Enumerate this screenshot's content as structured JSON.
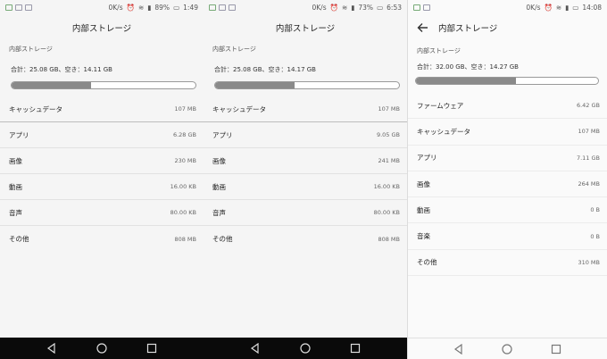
{
  "panels": [
    {
      "status": {
        "speed": "0K/s",
        "battery": "89%",
        "time": "1:49"
      },
      "title": "内部ストレージ",
      "section": "内部ストレージ",
      "summary": "合計：25.08 GB、空き：14.11 GB",
      "used_fraction": 0.43,
      "rows": [
        {
          "label": "キャッシュデータ",
          "value": "107 MB"
        },
        {
          "label": "アプリ",
          "value": "6.28 GB"
        },
        {
          "label": "画像",
          "value": "230 MB"
        },
        {
          "label": "動画",
          "value": "16.00 KB"
        },
        {
          "label": "音声",
          "value": "80.00 KB"
        },
        {
          "label": "その他",
          "value": "808 MB"
        }
      ]
    },
    {
      "status": {
        "speed": "0K/s",
        "battery": "73%",
        "time": "6:53"
      },
      "title": "内部ストレージ",
      "section": "内部ストレージ",
      "summary": "合計：25.08 GB、空き：14.17 GB",
      "used_fraction": 0.43,
      "rows": [
        {
          "label": "キャッシュデータ",
          "value": "107 MB"
        },
        {
          "label": "アプリ",
          "value": "9.05 GB"
        },
        {
          "label": "画像",
          "value": "241 MB"
        },
        {
          "label": "動画",
          "value": "16.00 KB"
        },
        {
          "label": "音声",
          "value": "80.00 KB"
        },
        {
          "label": "その他",
          "value": "808 MB"
        }
      ]
    },
    {
      "status": {
        "speed": "0K/s",
        "time": "14:08"
      },
      "title": "内部ストレージ",
      "section": "内部ストレージ",
      "summary": "合計：32.00 GB、空き：14.27 GB",
      "used_fraction": 0.55,
      "rows": [
        {
          "label": "ファームウェア",
          "value": "6.42 GB"
        },
        {
          "label": "キャッシュデータ",
          "value": "107 MB"
        },
        {
          "label": "アプリ",
          "value": "7.11 GB"
        },
        {
          "label": "画像",
          "value": "264 MB"
        },
        {
          "label": "動画",
          "value": "0 B"
        },
        {
          "label": "音楽",
          "value": "0 B"
        },
        {
          "label": "その他",
          "value": "310 MB"
        }
      ]
    }
  ],
  "colors": {
    "bar_fill": "#8a8a8a",
    "nav_dark": "#0a0a0a",
    "nav_light": "#fafafa"
  },
  "icons": [
    "back-arrow-icon",
    "wifi-icon",
    "signal-icon",
    "alarm-icon",
    "battery-icon",
    "nav-back-icon",
    "nav-home-icon",
    "nav-recents-icon"
  ]
}
